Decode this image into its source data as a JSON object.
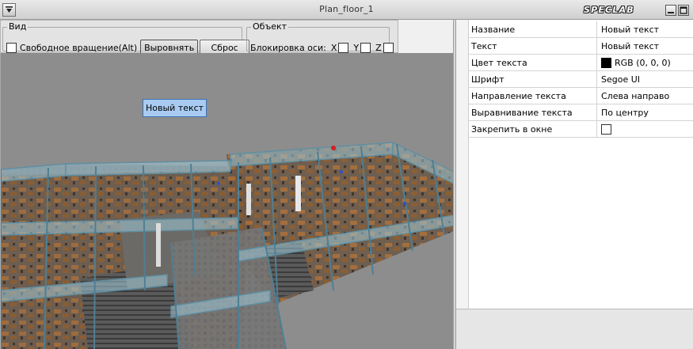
{
  "window": {
    "title": "Plan_floor_1",
    "brand": "SPECLAB"
  },
  "toolbar": {
    "view_group": {
      "legend": "Вид",
      "free_rotation_label": "Свободное вращение(Alt)",
      "free_rotation_checked": false,
      "align_button": "Выровнять",
      "reset_button": "Сброс"
    },
    "object_group": {
      "legend": "Объект",
      "axis_lock_label": "Блокировка оси:",
      "axes": [
        {
          "label": "X",
          "checked": false
        },
        {
          "label": "Y",
          "checked": false
        },
        {
          "label": "Z",
          "checked": false
        }
      ]
    }
  },
  "viewport": {
    "text_object_label": "Новый текст",
    "background_color": "#8d8d8d"
  },
  "properties": [
    {
      "name": "Название",
      "value": "Новый текст"
    },
    {
      "name": "Текст",
      "value": "Новый текст"
    },
    {
      "name": "Цвет текста",
      "value": "RGB (0, 0, 0)",
      "color": "#000000"
    },
    {
      "name": "Шрифт",
      "value": "Segoe UI"
    },
    {
      "name": "Направление текста",
      "value": "Слева направо"
    },
    {
      "name": "Выравнивание текста",
      "value": "По центру"
    },
    {
      "name": "Закрепить в окне",
      "checked": false
    }
  ]
}
